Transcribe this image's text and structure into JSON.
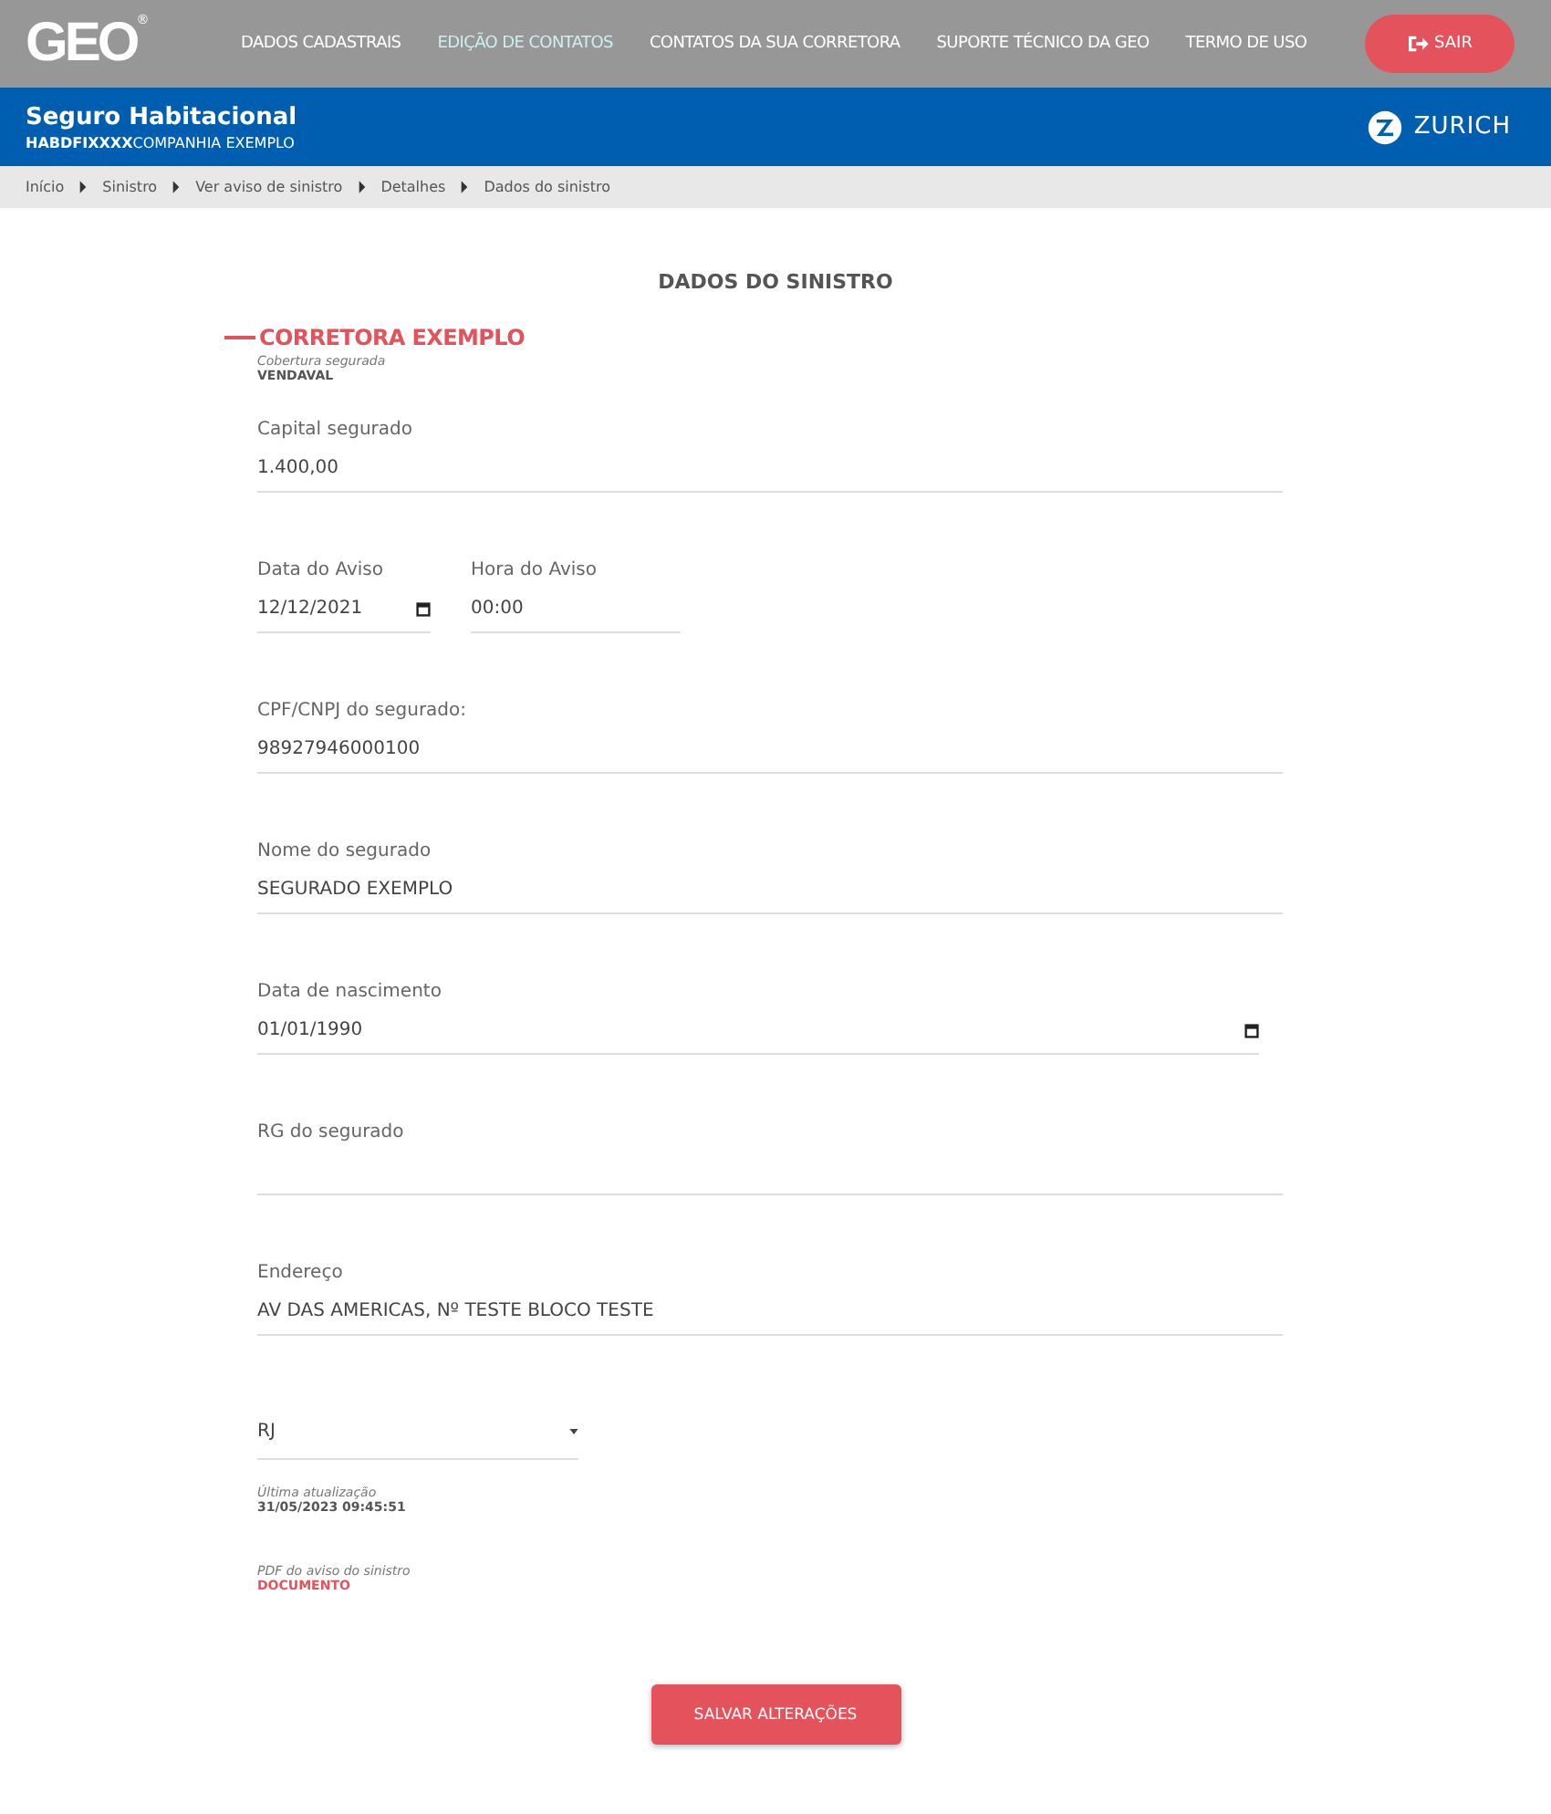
{
  "header": {
    "logo": "GEO",
    "logo_mark": "®",
    "nav": [
      {
        "label": "DADOS CADASTRAIS",
        "selected": false
      },
      {
        "label": "EDIÇÃO DE CONTATOS",
        "selected": true
      },
      {
        "label": "CONTATOS DA SUA CORRETORA",
        "selected": false
      },
      {
        "label": "SUPORTE TÉCNICO DA GEO",
        "selected": false
      },
      {
        "label": "TERMO DE USO",
        "selected": false
      }
    ],
    "logout": "SAIR"
  },
  "banner": {
    "title": "Seguro Habitacional",
    "code": "HABDFIXXXX",
    "company": "COMPANHIA EXEMPLO",
    "insurer": "ZURICH"
  },
  "breadcrumb": [
    "Início",
    "Sinistro",
    "Ver aviso de sinistro",
    "Detalhes",
    "Dados do sinistro"
  ],
  "page_title": "DADOS DO SINISTRO",
  "broker": "CORRETORA EXEMPLO",
  "coverage": {
    "label": "Cobertura segurada",
    "value": "VENDAVAL"
  },
  "fields": [
    {
      "kind": "text",
      "label": "Capital segurado",
      "value": "1.400,00"
    },
    {
      "kind": "pair",
      "items": [
        {
          "kind": "date",
          "label": "Data do Aviso",
          "value": "12/12/2021"
        },
        {
          "kind": "time",
          "label": "Hora do Aviso",
          "value": "00:00"
        }
      ]
    },
    {
      "kind": "text",
      "label": "CPF/CNPJ do segurado:",
      "value": "98927946000100"
    },
    {
      "kind": "text",
      "label": "Nome do segurado",
      "value": "SEGURADO EXEMPLO"
    },
    {
      "kind": "date",
      "label": "Data de nascimento",
      "value": "01/01/1990"
    },
    {
      "kind": "text",
      "label": "RG do segurado"
    },
    {
      "kind": "text",
      "label": "Endereço",
      "value": "AV DAS AMERICAS, Nº TESTE BLOCO TESTE"
    },
    {
      "kind": "select",
      "value": "RJ"
    }
  ],
  "last_update": {
    "label": "Última atualização",
    "value": "31/05/2023 09:45:51"
  },
  "pdf": {
    "label": "PDF do aviso do sinistro",
    "link": "DOCUMENTO"
  },
  "save": "SALVAR ALTERAÇÕES"
}
